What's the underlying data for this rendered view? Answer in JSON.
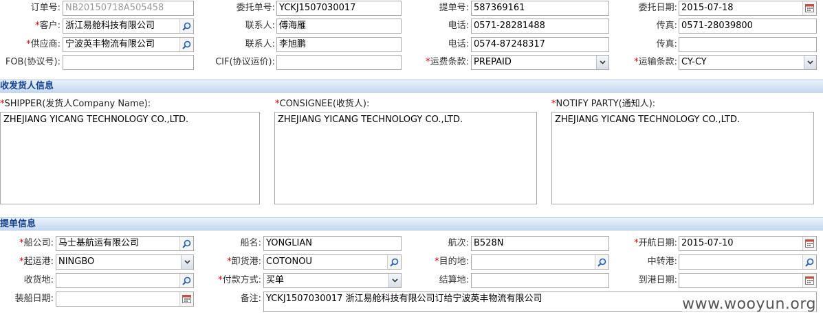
{
  "order": {
    "order_no_label": "订单号:",
    "order_no_value": "NB20150718A505458",
    "consign_no_label": "委托单号:",
    "consign_no_value": "YCKJ1507030017",
    "bill_no_label": "提单号:",
    "bill_no_value": "587369161",
    "consign_date_label": "委托日期:",
    "consign_date_value": "2015-07-18",
    "customer_label": "客户:",
    "customer_value": "浙江易舱科技有限公司",
    "contact1_label": "联系人:",
    "contact1_value": "傅海雁",
    "phone1_label": "电话:",
    "phone1_value": "0571-28281488",
    "fax1_label": "传真:",
    "fax1_value": "0571-28039800",
    "supplier_label": "供应商:",
    "supplier_value": "宁波英丰物流有限公司",
    "contact2_label": "联系人:",
    "contact2_value": "李旭鹏",
    "phone2_label": "电话:",
    "phone2_value": "0574-87248317",
    "fax2_label": "传真:",
    "fax2_value": "",
    "fob_label": "FOB(协议号):",
    "fob_value": "",
    "cif_label": "CIF(协议运价):",
    "cif_value": "",
    "freight_terms_label": "运费条款:",
    "freight_terms_value": "PREPAID",
    "transport_terms_label": "运输条款:",
    "transport_terms_value": "CY-CY"
  },
  "parties": {
    "section_title": "收发货人信息",
    "shipper_label": "SHIPPER(发货人Company Name):",
    "shipper_value": "ZHEJIANG YICANG TECHNOLOGY CO.,LTD.",
    "consignee_label": "CONSIGNEE(收货人):",
    "consignee_value": "ZHEJIANG YICANG TECHNOLOGY CO.,LTD.",
    "notify_label": "NOTIFY PARTY(通知人):",
    "notify_value": "ZHEJIANG YICANG TECHNOLOGY CO.,LTD."
  },
  "bill": {
    "section_title": "提单信息",
    "carrier_label": "船公司:",
    "carrier_value": "马士基航运有限公司",
    "vessel_label": "船名:",
    "vessel_value": "YONGLIAN",
    "voyage_label": "航次:",
    "voyage_value": "B528N",
    "sail_date_label": "开航日期:",
    "sail_date_value": "2015-07-10",
    "pol_label": "起运港:",
    "pol_value": "NINGBO",
    "pod_label": "卸货港:",
    "pod_value": "COTONOU",
    "dest_label": "目的地:",
    "dest_value": "",
    "transit_label": "中转港:",
    "transit_value": "",
    "receipt_label": "收货地:",
    "receipt_value": "",
    "payment_label": "付款方式:",
    "payment_value": "买单",
    "settle_label": "结算地:",
    "settle_value": "",
    "arrival_date_label": "到港日期:",
    "arrival_date_value": "",
    "load_date_label": "装船日期:",
    "load_date_value": "",
    "remark_label": "备注:",
    "remark_value": "YCKJ1507030017 浙江易舱科技有限公司订给宁波英丰物流有限公司"
  },
  "required_mark": "*",
  "watermark": "www.wooyun.org",
  "icons": {
    "lookup": "magnifier-icon",
    "date": "calendar-icon",
    "select": "chevron-down-icon"
  },
  "colors": {
    "section_text": "#15428b",
    "required": "#e00000",
    "border": "#a7a7a7"
  }
}
